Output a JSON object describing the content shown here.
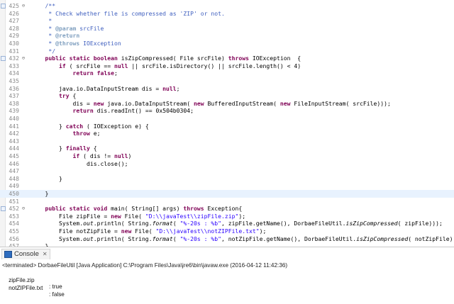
{
  "editor": {
    "lines": [
      {
        "num": "425",
        "fold": "⊖",
        "parts": [
          [
            "    ",
            "t"
          ],
          [
            "/**",
            "jd"
          ]
        ]
      },
      {
        "num": "426",
        "parts": [
          [
            "     * Check whether file is compressed as 'ZIP' or not.",
            "jd"
          ]
        ]
      },
      {
        "num": "427",
        "parts": [
          [
            "     *",
            "jd"
          ]
        ]
      },
      {
        "num": "428",
        "parts": [
          [
            "     * ",
            "jd"
          ],
          [
            "@param",
            "tag"
          ],
          [
            " srcFile",
            "jd"
          ]
        ]
      },
      {
        "num": "429",
        "parts": [
          [
            "     * ",
            "jd"
          ],
          [
            "@return",
            "tag"
          ]
        ]
      },
      {
        "num": "430",
        "parts": [
          [
            "     * ",
            "jd"
          ],
          [
            "@throws",
            "tag"
          ],
          [
            " IOException",
            "jd"
          ]
        ]
      },
      {
        "num": "431",
        "parts": [
          [
            "     */",
            "jd"
          ]
        ]
      },
      {
        "num": "432",
        "fold": "⊖",
        "parts": [
          [
            "    ",
            "t"
          ],
          [
            "public static boolean",
            "kw"
          ],
          [
            " isZipCompressed( File srcFile) ",
            "t"
          ],
          [
            "throws",
            "kw"
          ],
          [
            " IOException  {",
            "t"
          ]
        ]
      },
      {
        "num": "433",
        "parts": [
          [
            "        ",
            "t"
          ],
          [
            "if",
            "kw"
          ],
          [
            " ( srcFile == ",
            "t"
          ],
          [
            "null",
            "kw"
          ],
          [
            " || srcFile.isDirectory() || srcFile.length() < 4)",
            "t"
          ]
        ]
      },
      {
        "num": "434",
        "parts": [
          [
            "            ",
            "t"
          ],
          [
            "return false",
            "kw"
          ],
          [
            ";",
            "t"
          ]
        ]
      },
      {
        "num": "435",
        "parts": []
      },
      {
        "num": "436",
        "parts": [
          [
            "        java.io.DataInputStream dis = ",
            "t"
          ],
          [
            "null",
            "kw"
          ],
          [
            ";",
            "t"
          ]
        ]
      },
      {
        "num": "437",
        "parts": [
          [
            "        ",
            "t"
          ],
          [
            "try",
            "kw"
          ],
          [
            " {",
            "t"
          ]
        ]
      },
      {
        "num": "438",
        "parts": [
          [
            "            dis = ",
            "t"
          ],
          [
            "new",
            "kw"
          ],
          [
            " java.io.DataInputStream( ",
            "t"
          ],
          [
            "new",
            "kw"
          ],
          [
            " BufferedInputStream( ",
            "t"
          ],
          [
            "new",
            "kw"
          ],
          [
            " FileInputStream( srcFile)));",
            "t"
          ]
        ]
      },
      {
        "num": "439",
        "parts": [
          [
            "            ",
            "t"
          ],
          [
            "return",
            "kw"
          ],
          [
            " dis.readInt() == 0x504b0304;",
            "t"
          ]
        ]
      },
      {
        "num": "440",
        "parts": []
      },
      {
        "num": "441",
        "parts": [
          [
            "        } ",
            "t"
          ],
          [
            "catch",
            "kw"
          ],
          [
            " ( IOException e) {",
            "t"
          ]
        ]
      },
      {
        "num": "442",
        "parts": [
          [
            "            ",
            "t"
          ],
          [
            "throw",
            "kw"
          ],
          [
            " e;",
            "t"
          ]
        ]
      },
      {
        "num": "443",
        "parts": []
      },
      {
        "num": "444",
        "parts": [
          [
            "        } ",
            "t"
          ],
          [
            "finally",
            "kw"
          ],
          [
            " {",
            "t"
          ]
        ]
      },
      {
        "num": "445",
        "parts": [
          [
            "            ",
            "t"
          ],
          [
            "if",
            "kw"
          ],
          [
            " ( dis != ",
            "t"
          ],
          [
            "null",
            "kw"
          ],
          [
            ")",
            "t"
          ]
        ]
      },
      {
        "num": "446",
        "parts": [
          [
            "                dis.close();",
            "t"
          ]
        ]
      },
      {
        "num": "447",
        "parts": []
      },
      {
        "num": "448",
        "parts": [
          [
            "        }",
            "t"
          ]
        ]
      },
      {
        "num": "449",
        "parts": []
      },
      {
        "num": "450",
        "hl": true,
        "parts": [
          [
            "    }",
            "t"
          ]
        ]
      },
      {
        "num": "451",
        "parts": []
      },
      {
        "num": "452",
        "fold": "⊖",
        "parts": [
          [
            "    ",
            "t"
          ],
          [
            "public static void",
            "kw"
          ],
          [
            " main( String[] args) ",
            "t"
          ],
          [
            "throws",
            "kw"
          ],
          [
            " Exception{",
            "t"
          ]
        ]
      },
      {
        "num": "453",
        "parts": [
          [
            "        File zipFile = ",
            "t"
          ],
          [
            "new",
            "kw"
          ],
          [
            " File( ",
            "t"
          ],
          [
            "\"D:\\\\javaTest\\\\zipFile.zip\"",
            "str"
          ],
          [
            ");",
            "t"
          ]
        ]
      },
      {
        "num": "454",
        "parts": [
          [
            "        System.",
            "t"
          ],
          [
            "out",
            "it"
          ],
          [
            ".println( String.",
            "t"
          ],
          [
            "format",
            "it"
          ],
          [
            "( ",
            "t"
          ],
          [
            "\"%-20s : %b\"",
            "str"
          ],
          [
            ", zipFile.getName(), DorbaeFileUtil.",
            "t"
          ],
          [
            "isZipCompressed",
            "it"
          ],
          [
            "( zipFile)));",
            "t"
          ]
        ]
      },
      {
        "num": "455",
        "parts": [
          [
            "        File notZipFile = ",
            "t"
          ],
          [
            "new",
            "kw"
          ],
          [
            " File( ",
            "t"
          ],
          [
            "\"D:\\\\javaTest\\\\notZIPFile.txt\"",
            "str"
          ],
          [
            ");",
            "t"
          ]
        ]
      },
      {
        "num": "456",
        "parts": [
          [
            "        System.",
            "t"
          ],
          [
            "out",
            "it"
          ],
          [
            ".println( String.",
            "t"
          ],
          [
            "format",
            "it"
          ],
          [
            "( ",
            "t"
          ],
          [
            "\"%-20s : %b\"",
            "str"
          ],
          [
            ", notZipFile.getName(), DorbaeFileUtil.",
            "t"
          ],
          [
            "isZipCompressed",
            "it"
          ],
          [
            "( notZipFile)));",
            "t"
          ]
        ]
      },
      {
        "num": "457",
        "parts": [
          [
            "    }",
            "t"
          ]
        ]
      }
    ]
  },
  "console": {
    "tab_label": "Console",
    "tab_close": "✕",
    "status": "<terminated> DorbaeFileUtil [Java Application] C:\\Program Files\\Java\\jre6\\bin\\javaw.exe (2016-04-12 11:42:36)",
    "output": [
      {
        "name": "zipFile.zip",
        "value": ": true"
      },
      {
        "name": "notZIPFile.txt",
        "value": ": false"
      }
    ]
  }
}
